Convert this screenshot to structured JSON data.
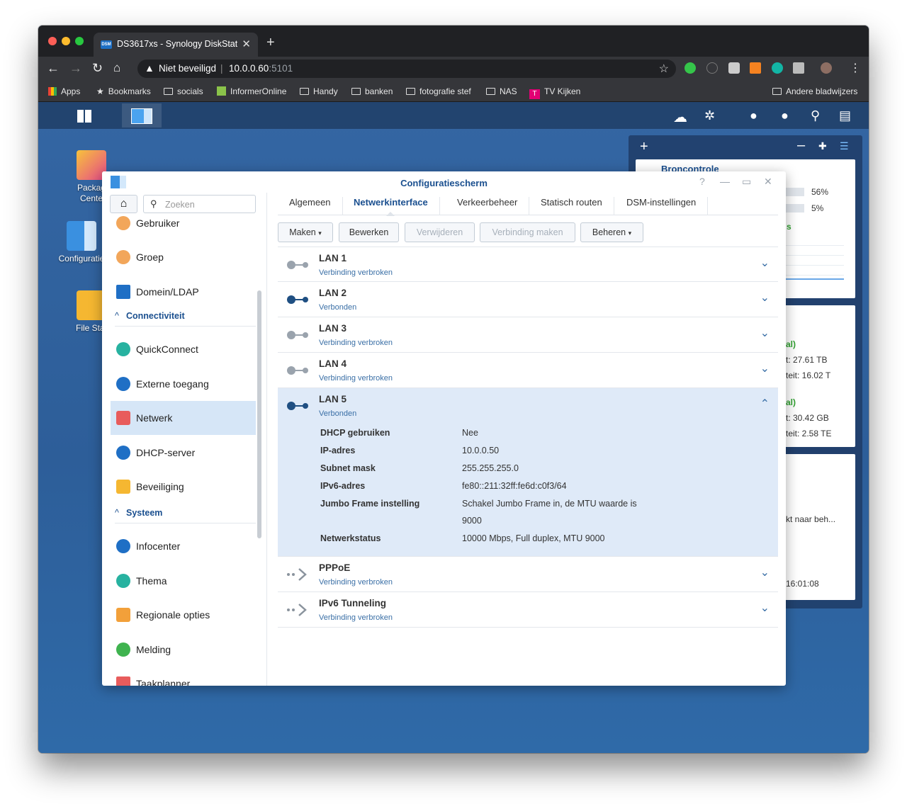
{
  "browser": {
    "tab_title": "DS3617xs - Synology DiskStation",
    "favicon_text": "DSM",
    "security_label": "Niet beveiligd",
    "url_host": "10.0.0.60",
    "url_port": ":5101",
    "bookmarks": [
      "Apps",
      "Bookmarks",
      "socials",
      "InformerOnline",
      "Handy",
      "banken",
      "fotografie stef",
      "NAS",
      "TV Kijken"
    ],
    "other_bookmarks": "Andere bladwijzers"
  },
  "desktop": {
    "icons": [
      "Packag\nCente",
      "Configuratie",
      "File Stat"
    ]
  },
  "widgets": {
    "card1_title": "Broncontrole",
    "card1_values": [
      "56%",
      "5%"
    ],
    "card1_tail": "s",
    "card2_rows": [
      "al)",
      "t: 27.61 TB",
      "teit: 16.02 T",
      "al)",
      "t: 30.42 GB",
      "teit: 2.58 TE"
    ],
    "card3_text": "kt naar beh...",
    "card3_time": "16:01:08"
  },
  "window": {
    "title": "Configuratiescherm",
    "search_placeholder": "Zoeken",
    "sidebar": {
      "items_top": [
        "Gebruiker",
        "Groep",
        "Domein/LDAP"
      ],
      "section_connectivity": "Connectiviteit",
      "items_conn": [
        "QuickConnect",
        "Externe toegang",
        "Netwerk",
        "DHCP-server",
        "Beveiliging"
      ],
      "section_system": "Systeem",
      "items_sys": [
        "Infocenter",
        "Thema",
        "Regionale opties",
        "Melding",
        "Taakplanner"
      ]
    },
    "tabs": [
      "Algemeen",
      "Netwerkinterface",
      "Verkeerbeheer",
      "Statisch routen",
      "DSM-instellingen"
    ],
    "buttons": [
      "Maken",
      "Bewerken",
      "Verwijderen",
      "Verbinding maken",
      "Beheren"
    ],
    "interfaces": [
      {
        "name": "LAN 1",
        "status": "Verbinding verbroken"
      },
      {
        "name": "LAN 2",
        "status": "Verbonden"
      },
      {
        "name": "LAN 3",
        "status": "Verbinding verbroken"
      },
      {
        "name": "LAN 4",
        "status": "Verbinding verbroken"
      },
      {
        "name": "LAN 5",
        "status": "Verbonden"
      },
      {
        "name": "PPPoE",
        "status": "Verbinding verbroken"
      },
      {
        "name": "IPv6 Tunneling",
        "status": "Verbinding verbroken"
      }
    ],
    "details": {
      "labels": [
        "DHCP gebruiken",
        "IP-adres",
        "Subnet mask",
        "IPv6-adres",
        "Jumbo Frame instelling",
        "Netwerkstatus"
      ],
      "values": [
        "Nee",
        "10.0.0.50",
        "255.255.255.0",
        "fe80::211:32ff:fe6d:c0f3/64",
        "Schakel Jumbo Frame in, de MTU waarde is",
        "10000 Mbps, Full duplex, MTU 9000"
      ],
      "jumbo_line2": "9000"
    }
  },
  "colors": {
    "accent": "#1a4f8f",
    "connected": "#1f4f82",
    "disconnected": "#9aa3ad",
    "selected_row": "#dfeaf8"
  }
}
